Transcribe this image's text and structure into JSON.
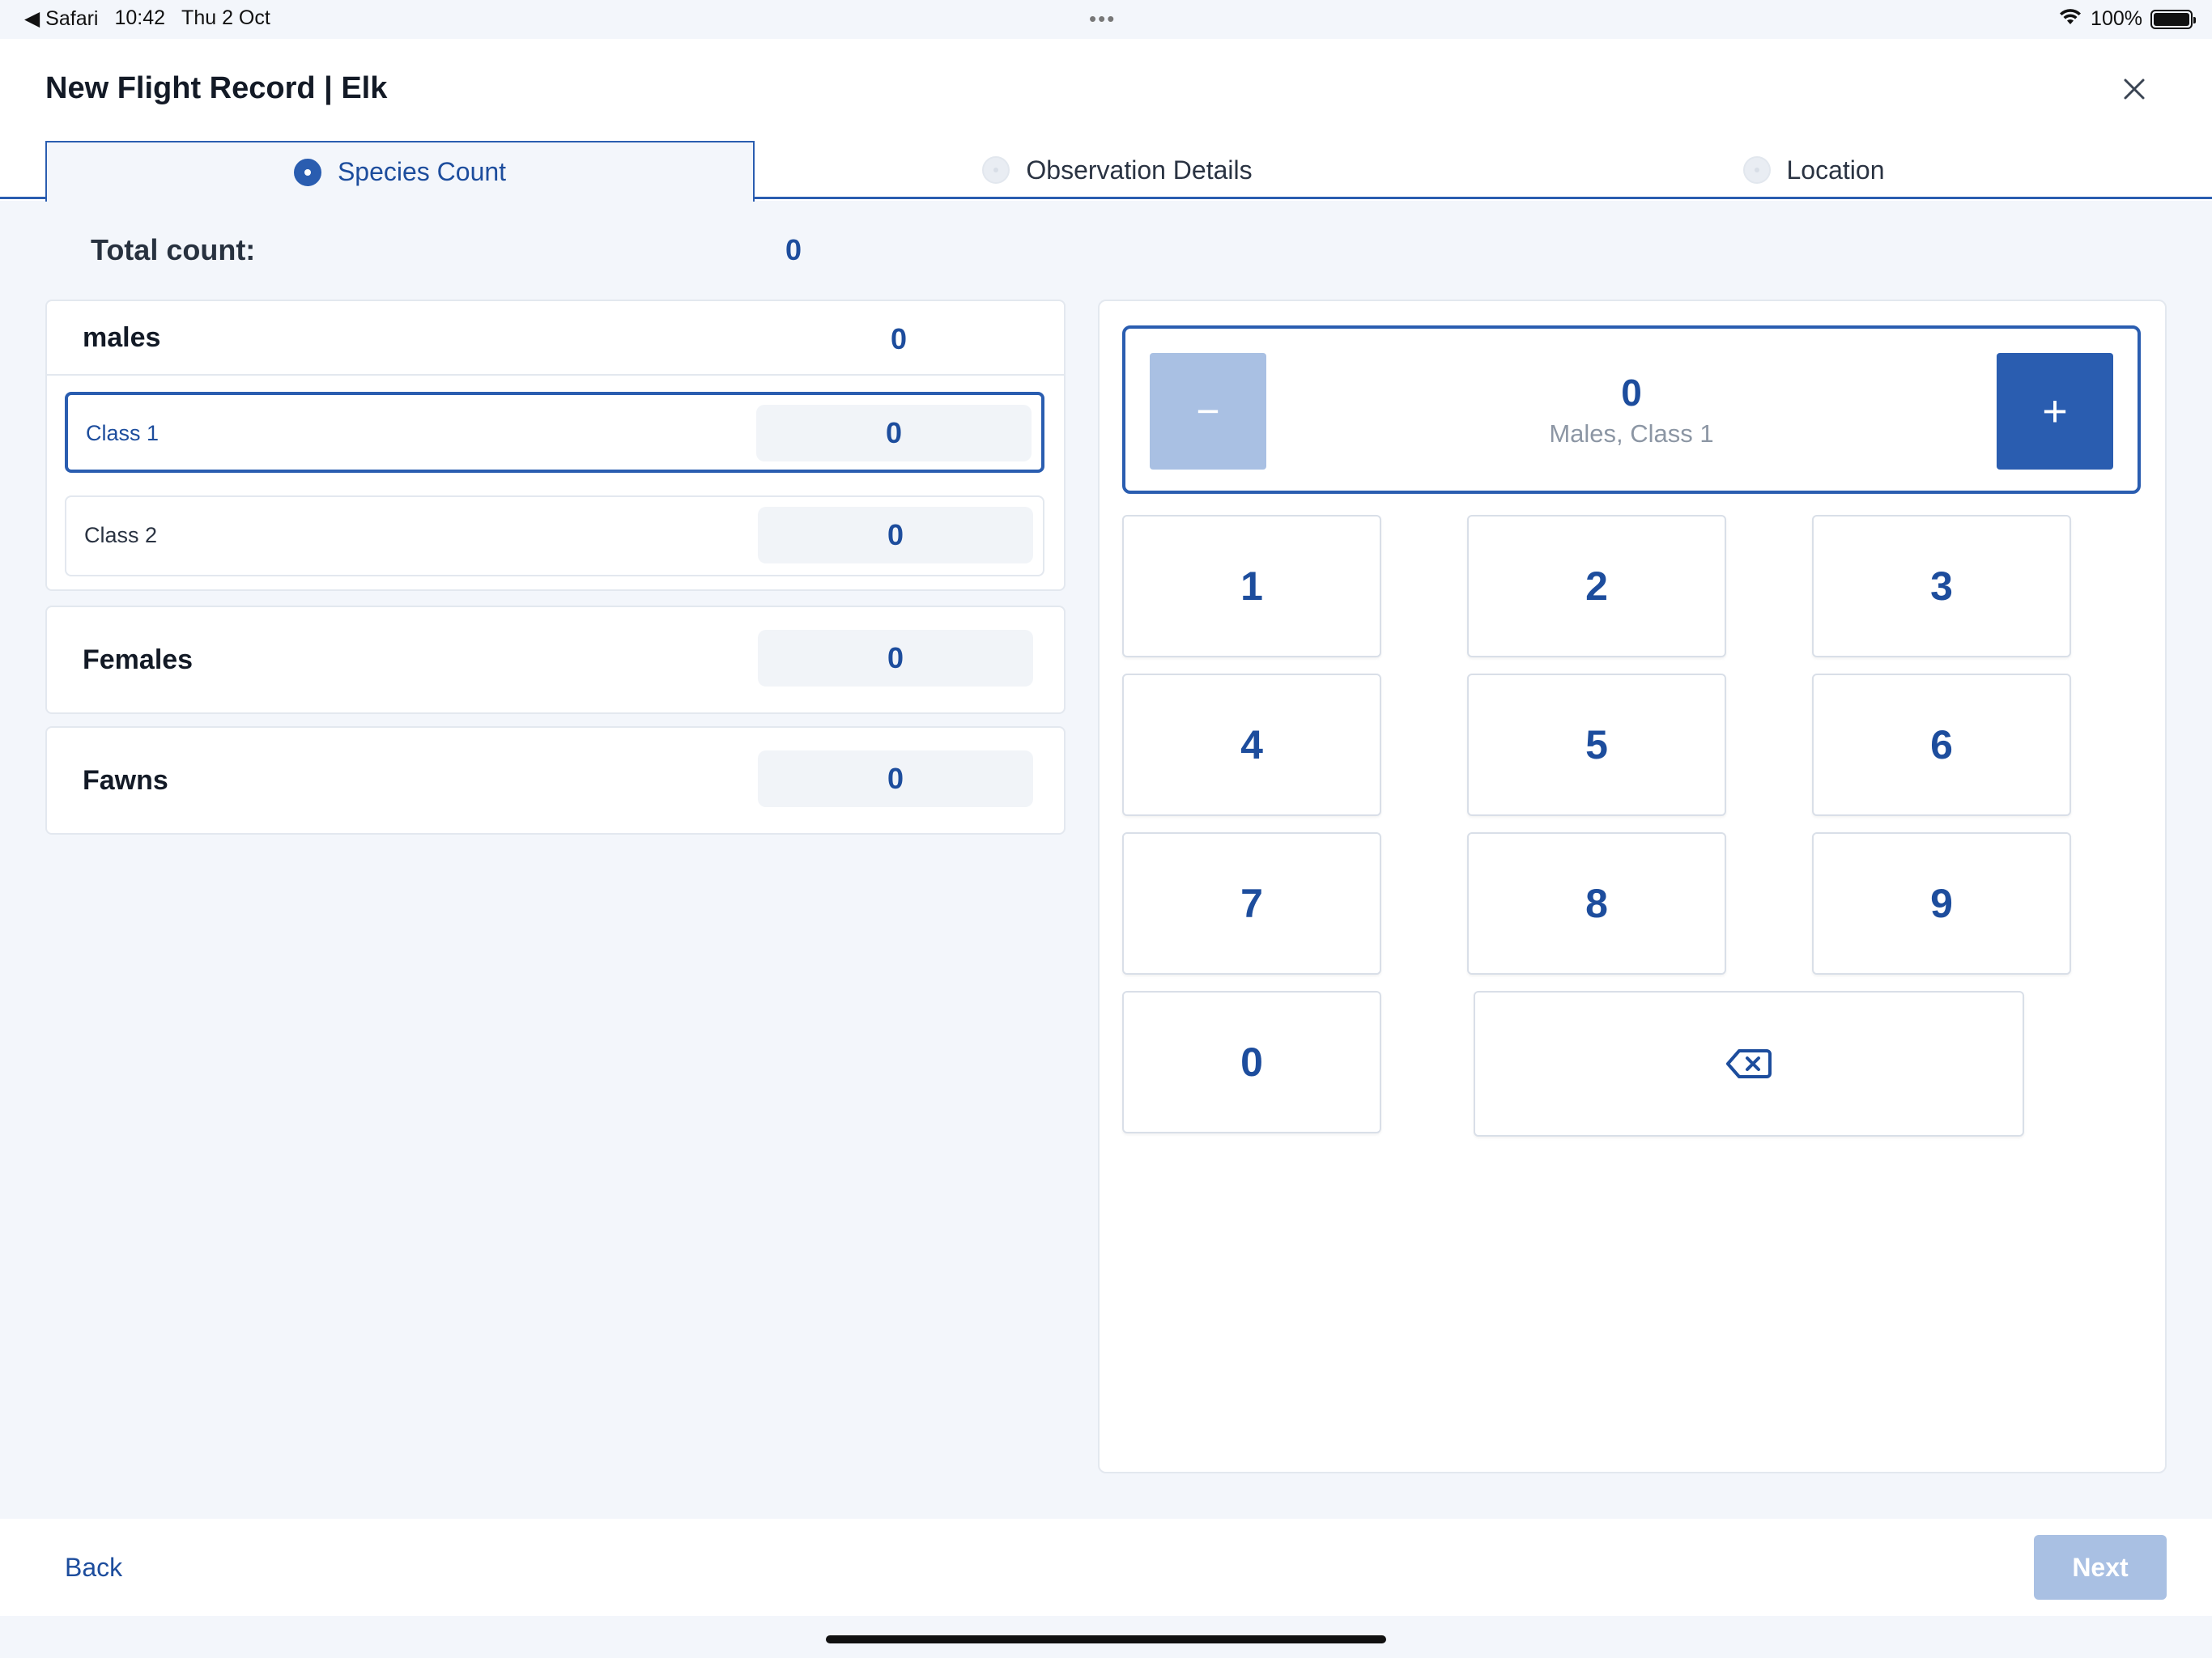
{
  "status_bar": {
    "back_app": "◀ Safari",
    "time": "10:42",
    "date": "Thu 2 Oct",
    "dots": "•••",
    "battery": "100%"
  },
  "header": {
    "title": "New Flight Record | Elk"
  },
  "tabs": [
    {
      "label": "Species Count",
      "active": true
    },
    {
      "label": "Observation Details",
      "active": false
    },
    {
      "label": "Location",
      "active": false
    }
  ],
  "total": {
    "label": "Total count:",
    "value": "0"
  },
  "males": {
    "label": "males",
    "value": "0",
    "classes": [
      {
        "label": "Class 1",
        "value": "0",
        "selected": true
      },
      {
        "label": "Class 2",
        "value": "0",
        "selected": false
      }
    ]
  },
  "females": {
    "label": "Females",
    "value": "0"
  },
  "fawns": {
    "label": "Fawns",
    "value": "0"
  },
  "counter": {
    "minus": "−",
    "plus": "+",
    "value": "0",
    "caption": "Males, Class 1"
  },
  "keypad": [
    "1",
    "2",
    "3",
    "4",
    "5",
    "6",
    "7",
    "8",
    "9",
    "0"
  ],
  "footer": {
    "back": "Back",
    "next": "Next"
  },
  "colors": {
    "accent": "#2a5db0",
    "accent_disabled": "#a9c0e3",
    "background": "#f3f6fb"
  }
}
